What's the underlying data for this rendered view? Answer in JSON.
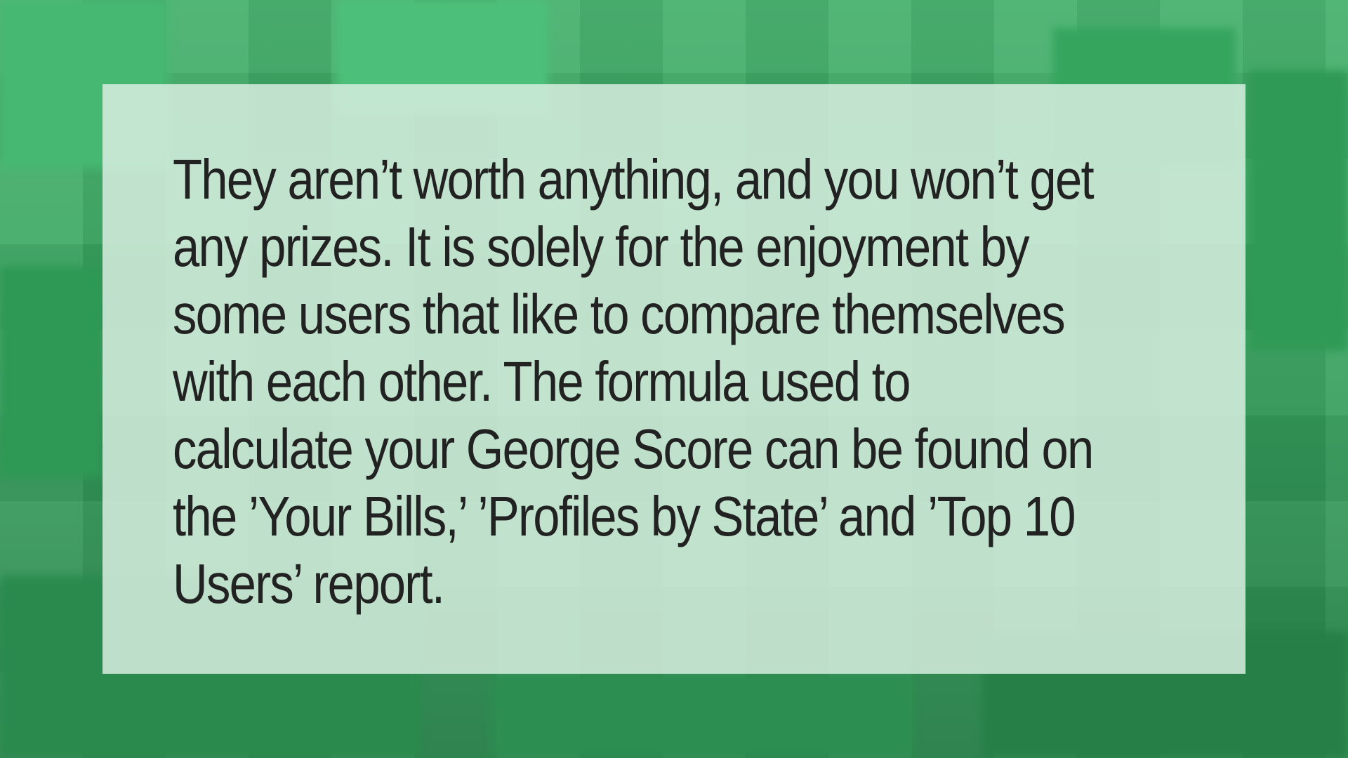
{
  "colors": {
    "background": "#3aa862",
    "card": "#d6eede",
    "text": "#222222"
  },
  "card": {
    "lines": [
      "They aren’t worth anything, and you won’t get",
      "any prizes. It is solely for the enjoyment by",
      "some users that like to compare themselves",
      "with each other. The formula used to",
      "calculate your George Score can be found on",
      "the ’Your Bills,’ ’Profiles by State’ and ’Top 10",
      "Users’ report."
    ]
  }
}
